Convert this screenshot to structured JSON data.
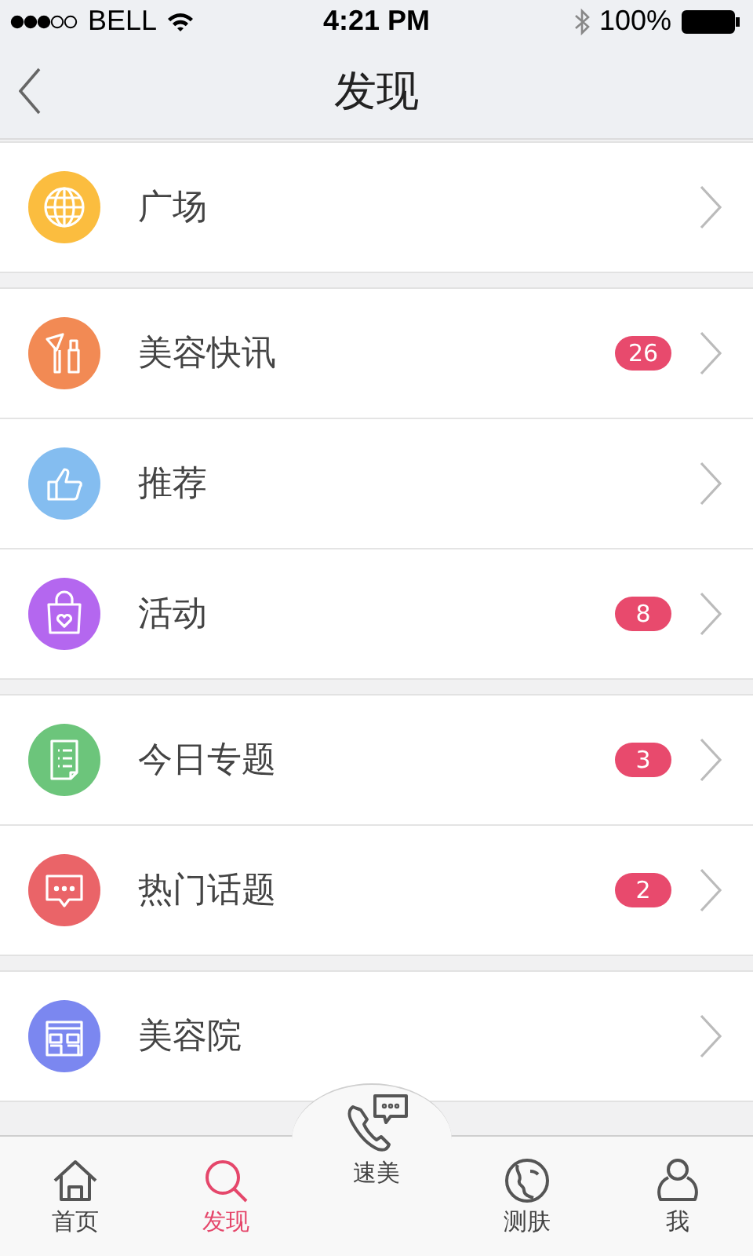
{
  "status_bar": {
    "carrier": "BELL",
    "time": "4:21 PM",
    "battery": "100%"
  },
  "nav": {
    "title": "发现"
  },
  "groups": [
    {
      "items": [
        {
          "label": "广场",
          "color": "#fbbd3f"
        }
      ]
    },
    {
      "items": [
        {
          "label": "美容快讯",
          "color": "#f28a54",
          "badge": "26"
        },
        {
          "label": "推荐",
          "color": "#84bdf0"
        },
        {
          "label": "活动",
          "color": "#b467ef",
          "badge": "8"
        }
      ]
    },
    {
      "items": [
        {
          "label": "今日专题",
          "color": "#6cc57b",
          "badge": "3"
        },
        {
          "label": "热门话题",
          "color": "#ea6468",
          "badge": "2"
        }
      ]
    },
    {
      "items": [
        {
          "label": "美容院",
          "color": "#7b87f0"
        }
      ]
    }
  ],
  "tabs": [
    {
      "label": "首页",
      "kind": "tab",
      "selected": false
    },
    {
      "label": "发现",
      "kind": "tab",
      "selected": true
    },
    {
      "label": "速美",
      "kind": "raised",
      "selected": false
    },
    {
      "label": "测肤",
      "kind": "tab",
      "selected": false
    },
    {
      "label": "我",
      "kind": "tab",
      "selected": false
    }
  ]
}
